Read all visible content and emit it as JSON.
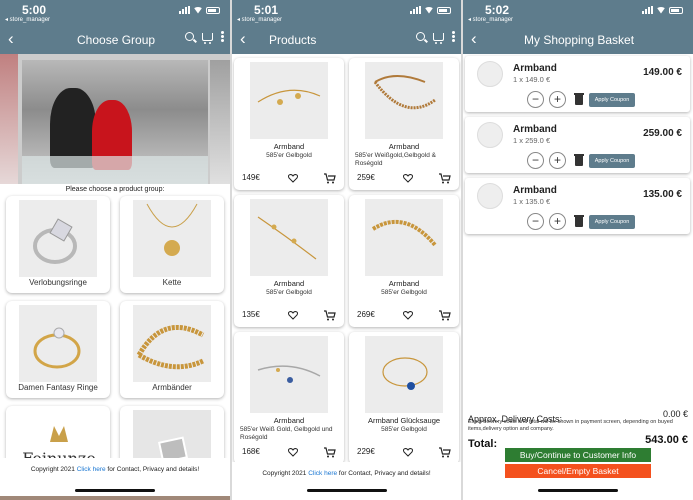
{
  "colors": {
    "appbar": "#5e7c8c",
    "link": "#1976d2",
    "buy_button": "#2e7d32",
    "cancel_button": "#f4511e"
  },
  "screen1": {
    "status": {
      "time": "5:00",
      "app": "◂ store_manager"
    },
    "title": "Choose Group",
    "subtitle": "Please choose a product group:",
    "groups": [
      {
        "label": "Verlobungsringe"
      },
      {
        "label": "Kette"
      },
      {
        "label": "Damen Fantasy Ringe"
      },
      {
        "label": "Armbänder"
      },
      {
        "label": ""
      },
      {
        "label": ""
      }
    ],
    "logo_text": "Feinunze",
    "footer": {
      "prefix": "Copyright 2021 ",
      "link": "Click here",
      "suffix": " for Contact, Privacy and details!"
    }
  },
  "screen2": {
    "status": {
      "time": "5:01",
      "app": "◂ store_manager"
    },
    "title": "Products",
    "products": [
      {
        "name": "Armband",
        "desc": "585'er Gelbgold",
        "price": "149€"
      },
      {
        "name": "Armband",
        "desc": "585'er Weißgold,Gelbgold & Roségold",
        "price": "259€"
      },
      {
        "name": "Armband",
        "desc": "585'er Gelbgold",
        "price": "135€"
      },
      {
        "name": "Armband",
        "desc": "585'er Gelbgold",
        "price": "269€"
      },
      {
        "name": "Armband",
        "desc": "585'er Weiß Gold, Gelbgold und Roségold",
        "price": "168€"
      },
      {
        "name": "Armband Glücksauge",
        "desc": "585'er Gelbgold",
        "price": "229€"
      }
    ],
    "footer": {
      "prefix": "Copyright 2021 ",
      "link": "Click here",
      "suffix": " for Contact, Privacy and details!"
    }
  },
  "screen3": {
    "status": {
      "time": "5:02",
      "app": "◂ store_manager"
    },
    "title": "My Shopping Basket",
    "items": [
      {
        "name": "Armband",
        "qty": "1 x 149.0 €",
        "price": "149.00 €",
        "coupon": "Apply Coupon"
      },
      {
        "name": "Armband",
        "qty": "1 x 259.0 €",
        "price": "259.00 €",
        "coupon": "Apply Coupon"
      },
      {
        "name": "Armband",
        "qty": "1 x 135.0 €",
        "price": "135.00 €",
        "coupon": "Apply Coupon"
      }
    ],
    "delivery_label": "Approx. Delivery Costs:",
    "delivery_value": "0.00 €",
    "delivery_note": "Exact delivery costs and total will be shown in payment screen, depending on buyed items,delivery option and company.",
    "total_label": "Total:",
    "total_value": "543.00 €",
    "buy_label": "Buy/Continue to Customer Info",
    "cancel_label": "Cancel/Empty Basket"
  }
}
